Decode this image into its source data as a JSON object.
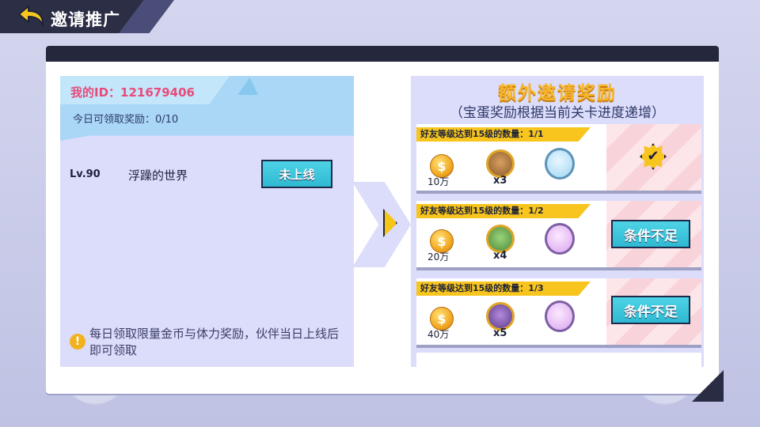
{
  "header": {
    "title": "邀请推广",
    "back_icon": "back-arrow-icon"
  },
  "left": {
    "my_id": "我的ID：121679406",
    "daily_claim": "今日可领取奖励：0/10",
    "friend": {
      "level": "Lv.90",
      "name": "浮躁的世界",
      "status_button": "未上线"
    },
    "tip": "每日领取限量金币与体力奖励，伙伴当日上线后即可领取"
  },
  "right": {
    "title": "额外邀请奖励",
    "subtitle": "（宝蛋奖励根据当前关卡进度递增）",
    "rows": [
      {
        "requirement": "好友等级达到15级的数量：1/1",
        "coin_qty": "10万",
        "hero_qty": "x3",
        "egg_color": "#bfe3f7",
        "status": "claimed",
        "status_icon": "check-badge-icon"
      },
      {
        "requirement": "好友等级达到15级的数量：1/2",
        "coin_qty": "20万",
        "hero_qty": "x4",
        "egg_color": "#e3b7ef",
        "status_button": "条件不足"
      },
      {
        "requirement": "好友等级达到15级的数量：1/3",
        "coin_qty": "40万",
        "hero_qty": "x5",
        "egg_color": "#e3b7ef",
        "status_button": "条件不足"
      }
    ]
  },
  "colors": {
    "accent_yellow": "#f7c51e",
    "button_cyan": "#2fb9d2",
    "id_pink": "#e84b7a",
    "panel_lavender": "#dcdcfb"
  }
}
